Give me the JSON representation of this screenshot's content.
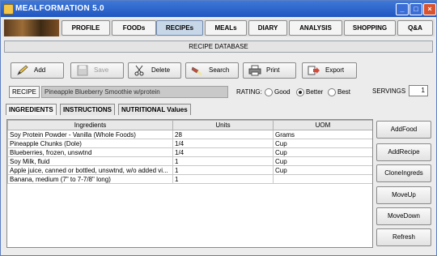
{
  "window": {
    "title": "MEALFORMATION 5.0"
  },
  "nav": {
    "tabs": [
      {
        "label": "PROFILE"
      },
      {
        "label": "FOODs"
      },
      {
        "label": "RECIPEs",
        "active": true
      },
      {
        "label": "MEALs"
      },
      {
        "label": "DIARY"
      },
      {
        "label": "ANALYSIS"
      },
      {
        "label": "SHOPPING"
      },
      {
        "label": "Q&A"
      }
    ]
  },
  "database_title": "RECIPE DATABASE",
  "toolbar": {
    "add": "Add",
    "save": "Save",
    "delete": "Delete",
    "search": "Search",
    "print": "Print",
    "export": "Export"
  },
  "recipe": {
    "label": "RECIPE",
    "name": "Pineapple Blueberry  Smoothie w/protein",
    "rating_label": "RATING:",
    "ratings": [
      "Good",
      "Better",
      "Best"
    ],
    "selected_rating": "Better",
    "servings_label": "SERVINGS",
    "servings": "1"
  },
  "subtabs": [
    "INGREDIENTS",
    "INSTRUCTIONS",
    "NUTRITIONAL Values"
  ],
  "table": {
    "headers": [
      "Ingredients",
      "Units",
      "UOM"
    ],
    "rows": [
      [
        "Soy Protein Powder - Vanilla (Whole Foods)",
        "28",
        "Grams"
      ],
      [
        "Pineapple Chunks (Dole)",
        "1/4",
        "Cup"
      ],
      [
        "Blueberries, frozen, unswtnd",
        "1/4",
        "Cup"
      ],
      [
        "Soy Milk, fluid",
        "1",
        "Cup"
      ],
      [
        "Apple juice, canned or bottled, unswtnd, w/o added vi...",
        "1",
        "Cup"
      ],
      [
        "Banana, medium (7\" to 7-7/8\" long)",
        "1",
        ""
      ]
    ]
  },
  "side_buttons": [
    "AddFood",
    "AddRecipe",
    "CloneIngreds",
    "MoveUp",
    "MoveDown",
    "Refresh"
  ]
}
